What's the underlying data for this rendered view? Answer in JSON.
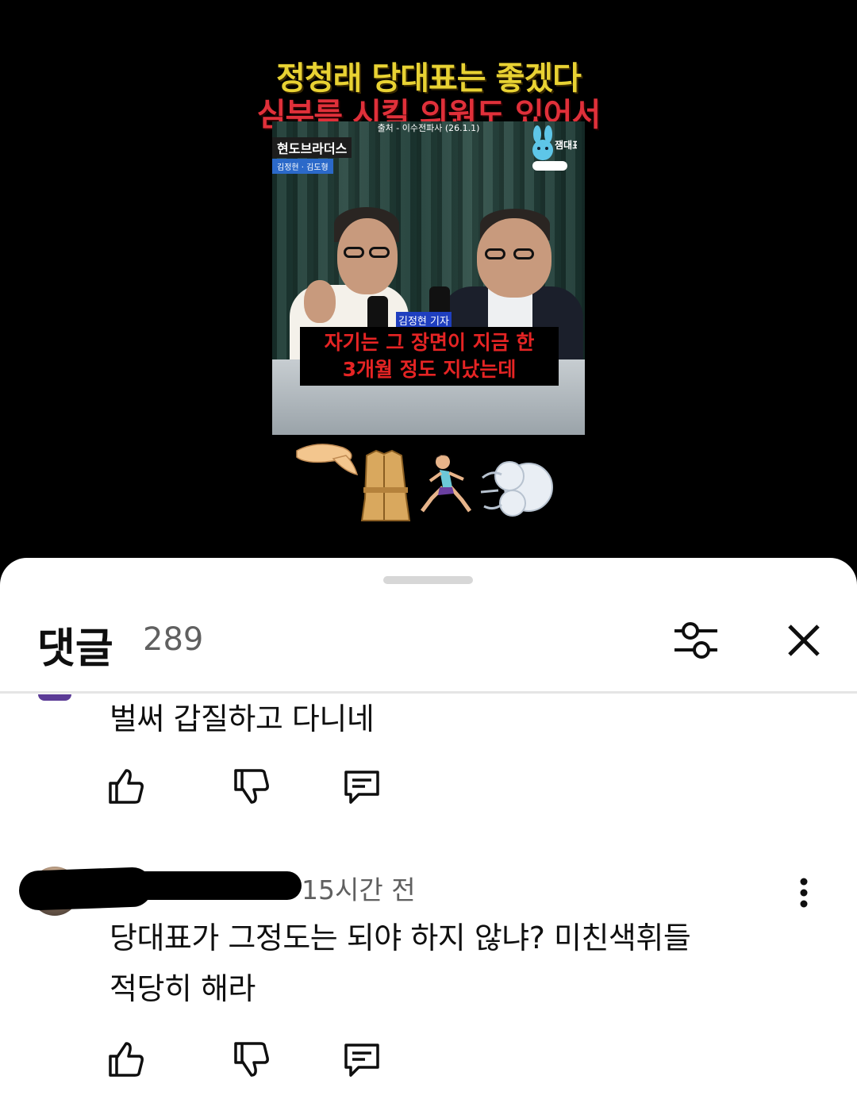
{
  "video": {
    "headline_line1": "정청래 당대표는 좋겠다",
    "headline_line2": "심부름 시킬 의원도 있어서",
    "source": "출처 - 이수전파사 (26.1.1)",
    "show_logo": "현도브라더스",
    "show_names": "김정현 · 김도형",
    "channel_logo": "잼대표",
    "name_tag": "김정현 기자",
    "caption_line1": "자기는 그 장면이 지금 한",
    "caption_line2": "3개월 정도 지났는데",
    "emojis": [
      "🤏",
      "🧥",
      "🏃‍♀️",
      "💨"
    ]
  },
  "comments_panel": {
    "title": "댓글",
    "count": "289",
    "icons": {
      "filter": "filter-sliders-icon",
      "close": "close-icon"
    }
  },
  "comments": [
    {
      "text": "벌써 갑질하고 다니네",
      "actions": {
        "like": "thumbs-up-icon",
        "dislike": "thumbs-down-icon",
        "reply": "reply-icon"
      }
    },
    {
      "time": "15시간 전",
      "text_line1": "당대표가 그정도는 되야 하지 않냐? 미친색휘들",
      "text_line2": "적당히 해라",
      "actions": {
        "like": "thumbs-up-icon",
        "dislike": "thumbs-down-icon",
        "reply": "reply-icon"
      }
    }
  ],
  "colors": {
    "headline_yellow": "#e8d233",
    "headline_red": "#e0303a",
    "caption_red": "#e52424",
    "meta_gray": "#606060"
  }
}
